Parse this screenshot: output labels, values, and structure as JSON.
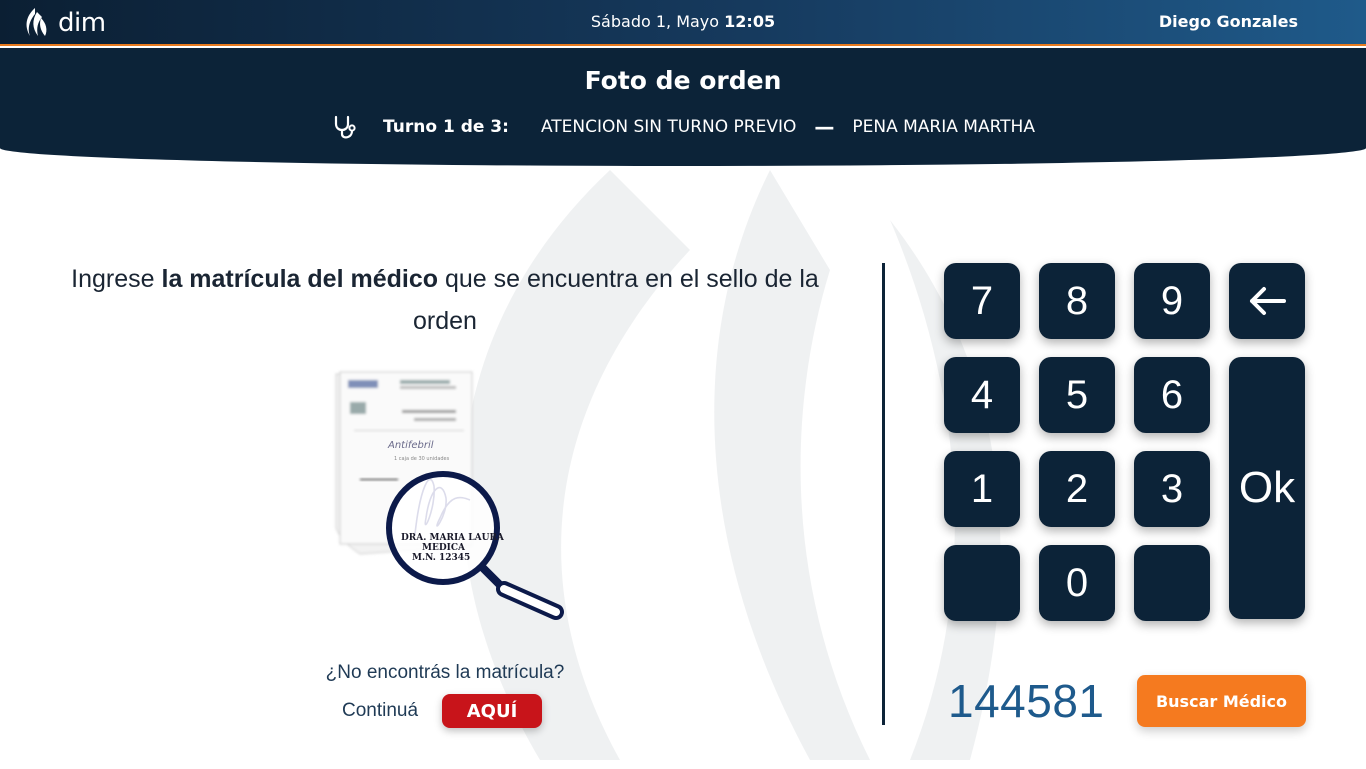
{
  "topbar": {
    "logo_text": "dim",
    "date_text": "Sábado 1, Mayo",
    "time_text": "12:05",
    "user_name": "Diego Gonzales",
    "accent_color": "#e87a1e"
  },
  "header": {
    "title": "Foto de orden",
    "turno_label": "Turno 1 de 3:",
    "turno_type": "ATENCION SIN TURNO PREVIO",
    "separator": "—",
    "patient_name": "PENA MARIA MARTHA",
    "icon": "stethoscope-icon"
  },
  "instruction": {
    "prefix": "Ingrese ",
    "bold": "la matrícula del médico",
    "suffix": " que se encuentra en el sello de la orden"
  },
  "illustration": {
    "doc_title": "Antifebril",
    "doc_subtitle": "1 caja de 30 unidades",
    "stamp_line1": "DRA. MARIA LAURA",
    "stamp_line2": "MEDICA",
    "stamp_line3": "M.N. 12345"
  },
  "help": {
    "question": "¿No encontrás la matrícula?",
    "continue_label": "Continuá",
    "aqui_label": "AQUÍ"
  },
  "keypad": {
    "k7": "7",
    "k8": "8",
    "k9": "9",
    "back": "←",
    "k4": "4",
    "k5": "5",
    "k6": "6",
    "k1": "1",
    "k2": "2",
    "k3": "3",
    "k0": "0",
    "ok": "Ok"
  },
  "entry": {
    "value": "144581",
    "search_label": "Buscar Médico"
  },
  "colors": {
    "navy": "#0c2338",
    "orange": "#f57a1f",
    "red": "#c8141a",
    "value_blue": "#1e5a8c"
  }
}
